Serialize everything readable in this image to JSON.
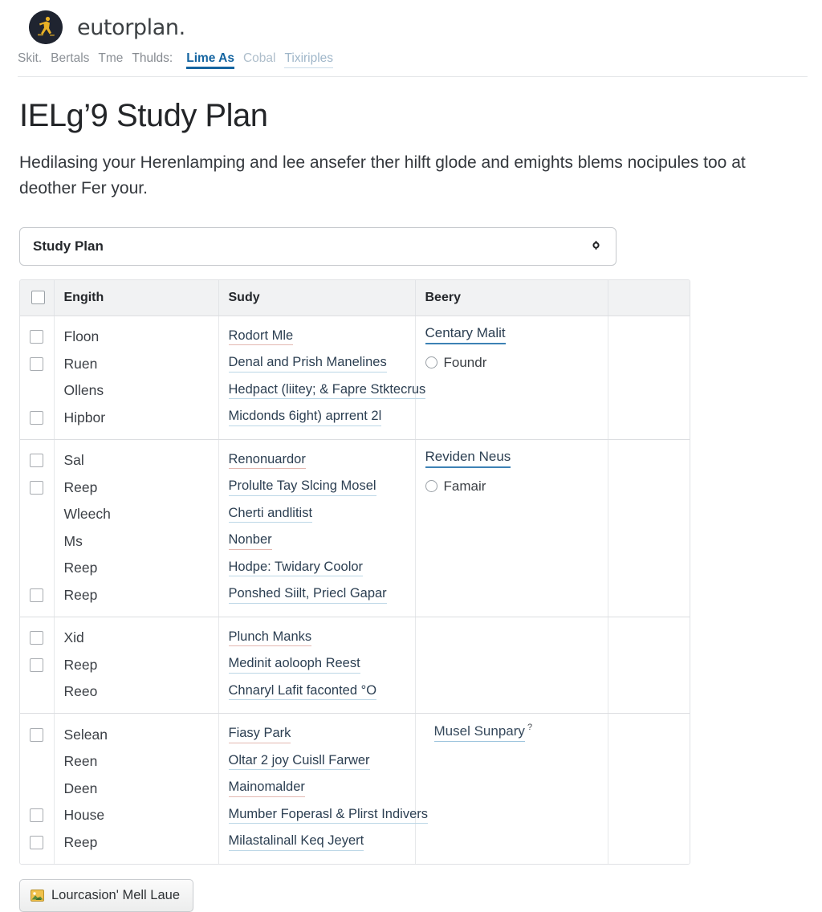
{
  "brand": {
    "name": "eutorplan",
    "name_suffix": ".",
    "logo_icon": "runner-circle-logo"
  },
  "navbar": {
    "crumbs": [
      "Skit.",
      "Bertals",
      "Tme",
      "Thulds:"
    ],
    "tabs": [
      {
        "label": "Lime As",
        "active": true
      },
      {
        "label": "Cobal",
        "active": false
      },
      {
        "label": "Tixiriples",
        "active": false
      }
    ]
  },
  "page": {
    "title": "IELg’9 Study Plan",
    "intro": "Hedilasing your Herenlamping and lee ansefer ther hilft glode and emights blems nocipules too at deother Fer your."
  },
  "select": {
    "label": "Study Plan",
    "caret_icon": "diamond-caret-icon"
  },
  "table": {
    "headers": {
      "check": "",
      "engith": "Engith",
      "sudy": "Sudy",
      "beery": "Beery",
      "last": ""
    },
    "groups": [
      {
        "checks": [
          true,
          true,
          false,
          true
        ],
        "engith": [
          "Floon",
          "Ruen",
          "Ollens",
          "Hipbor"
        ],
        "sudy": [
          {
            "text": "Rodort Mle",
            "underline": "red"
          },
          {
            "text": "Denal and Prish Manelines",
            "underline": "blue"
          },
          {
            "text": "Hedpact (liitey; & Fapre Stktecrus",
            "underline": "blue"
          },
          {
            "text": "Micdonds 6ight) aprrent 2l",
            "underline": "blue"
          }
        ],
        "beery": {
          "heading": "Centary Malit",
          "heading_style": "strong",
          "option": "Foundr",
          "indent": false,
          "sup": ""
        }
      },
      {
        "checks": [
          true,
          true,
          false,
          false,
          false,
          true
        ],
        "engith": [
          "Sal",
          "Reep",
          "Wleech",
          "Mѕ",
          "Reep",
          "Reep"
        ],
        "sudy": [
          {
            "text": "Renonuardor",
            "underline": "red"
          },
          {
            "text": "Prolulte Tay Slcing Mosel",
            "underline": "blue"
          },
          {
            "text": "Cherti andlitist",
            "underline": "blue"
          },
          {
            "text": "Nonber",
            "underline": "red"
          },
          {
            "text": "Hodpe: Twidary Coolor",
            "underline": "blue"
          },
          {
            "text": "Ponshed Siilt, Priecl Gapar",
            "underline": "blue"
          }
        ],
        "beery": {
          "heading": "Reviden Neus",
          "heading_style": "strong",
          "option": "Famair",
          "indent": false,
          "sup": ""
        }
      },
      {
        "checks": [
          true,
          true,
          false
        ],
        "engith": [
          "Xid",
          "Reep",
          "Reeo"
        ],
        "sudy": [
          {
            "text": "Plunch Manks",
            "underline": "red"
          },
          {
            "text": "Medinit aolooph Reest",
            "underline": "blue"
          },
          {
            "text": "Chnaryl Lafit faconted °O",
            "underline": "blue"
          }
        ],
        "beery": {
          "heading": "",
          "heading_style": "none",
          "option": "",
          "indent": false,
          "sup": ""
        }
      },
      {
        "checks": [
          true,
          false,
          false,
          true,
          true
        ],
        "engith": [
          "Selean",
          "Reen",
          "Deen",
          "House",
          "Reep"
        ],
        "sudy": [
          {
            "text": "Fiasy Park",
            "underline": "red"
          },
          {
            "text": "Oltar 2 joy Cuisll Farwer",
            "underline": "blue"
          },
          {
            "text": "Mainomalder",
            "underline": "red"
          },
          {
            "text": "Mumber Foperasl & Plirst Indivers",
            "underline": "blue"
          },
          {
            "text": "Milastalinall Keq Jeyert",
            "underline": "blue"
          }
        ],
        "beery": {
          "heading": "Musel Sunpary",
          "heading_style": "thin",
          "option": "",
          "indent": true,
          "sup": "?"
        }
      }
    ]
  },
  "footer": {
    "button_label": "Lourcasion' Mell Laue",
    "button_icon": "download-image-icon"
  },
  "colors": {
    "accent": "#1464a0",
    "link": "#2c3f52",
    "underline_blue": "#bcd7e6",
    "underline_red": "#e3b7b0",
    "logo_bg": "#1f2430",
    "logo_fg": "#e8b126"
  }
}
